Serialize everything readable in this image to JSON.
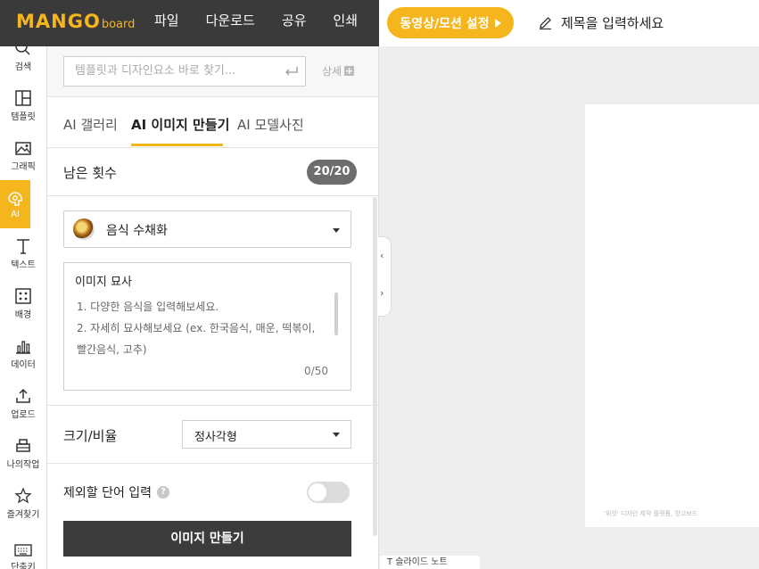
{
  "logo": {
    "main": "MANGO",
    "sub": "board"
  },
  "menu": [
    "파일",
    "다운로드",
    "공유",
    "인쇄"
  ],
  "video_button": "동영상/모션 설정",
  "title_placeholder": "제목을 입력하세요",
  "rail": [
    {
      "label": "검색",
      "icon": "search-icon"
    },
    {
      "label": "템플릿",
      "icon": "template-icon"
    },
    {
      "label": "그래픽",
      "icon": "graphic-icon"
    },
    {
      "label": "AI",
      "icon": "ai-icon",
      "active": true
    },
    {
      "label": "텍스트",
      "icon": "text-icon"
    },
    {
      "label": "배경",
      "icon": "background-icon"
    },
    {
      "label": "데이터",
      "icon": "chart-icon"
    },
    {
      "label": "업로드",
      "icon": "upload-icon"
    },
    {
      "label": "나의작업",
      "icon": "mywork-icon"
    },
    {
      "label": "즐겨찾기",
      "icon": "star-icon"
    },
    {
      "label": "단축키",
      "icon": "keyboard-icon"
    }
  ],
  "search": {
    "placeholder": "템플릿과 디자인요소 바로 찾기...",
    "detail_label": "상세"
  },
  "tabs": [
    "AI 갤러리",
    "AI 이미지 만들기",
    "AI 모델사진"
  ],
  "remaining": {
    "label": "남은 횟수",
    "value": "20/20"
  },
  "style_select": {
    "value": "음식 수채화"
  },
  "description": {
    "title": "이미지 묘사",
    "lines": [
      "1. 다양한 음식을 입력해보세요.",
      "2. 자세히 묘사해보세요 (ex. 한국음식, 매운, 떡볶이,",
      "빨간음식, 고추)"
    ],
    "count": "0/50"
  },
  "size": {
    "label": "크기/비율",
    "value": "정사각형"
  },
  "exclude": {
    "label": "제외할 단어 입력",
    "help": "?"
  },
  "make_button": "이미지 만들기",
  "canvas": {
    "watermark": "'위잇' 디자인 제작 플랫폼, 망고보드"
  },
  "slide_note": "T 슬라이드 노트",
  "colors": {
    "accent": "#f5b51c",
    "topbar": "#3a3a3a",
    "button_dark": "#3c3c3c"
  }
}
